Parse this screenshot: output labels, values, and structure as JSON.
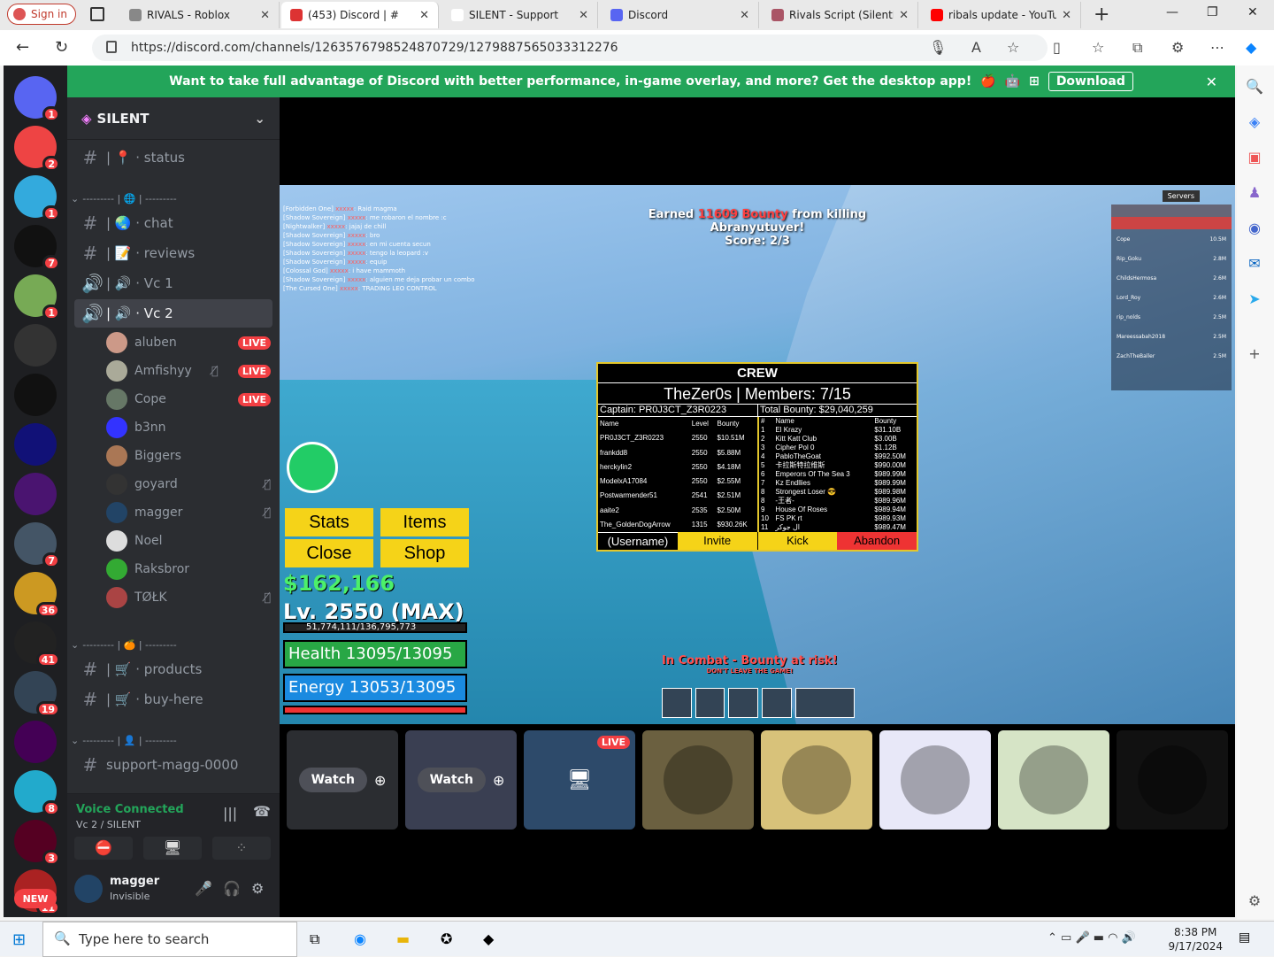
{
  "browser": {
    "signin": "Sign in",
    "tabs": [
      {
        "title": "RIVALS - Roblox",
        "fav": "#888"
      },
      {
        "title": "(453) Discord | #",
        "fav": "#d33",
        "active": true
      },
      {
        "title": "SILENT - Support",
        "fav": "#fff"
      },
      {
        "title": "Discord",
        "fav": "#5865f2"
      },
      {
        "title": "Rivals Script (SilentHub",
        "fav": "#a56"
      },
      {
        "title": "ribals update - YouTub",
        "fav": "#f00"
      }
    ],
    "url": "https://discord.com/channels/1263576798524870729/1279887565033312276"
  },
  "banner": {
    "text": "Want to take full advantage of Discord with better performance, in-game overlay, and more? Get the desktop app!",
    "download": "Download"
  },
  "server": {
    "name": "SILENT",
    "channels": [
      {
        "type": "text",
        "label": "| 📍 · status"
      },
      {
        "type": "category",
        "label": "--------- | 🌐 | ---------"
      },
      {
        "type": "text",
        "label": "| 🌏 · chat"
      },
      {
        "type": "text",
        "label": "| 📝 · reviews"
      },
      {
        "type": "voice",
        "label": "| 🔊 · Vc 1"
      },
      {
        "type": "voice",
        "label": "| 🔊 · Vc 2",
        "active": true
      }
    ],
    "voice_users": [
      {
        "name": "aluben",
        "live": "LIVE",
        "color": "#c98"
      },
      {
        "name": "Amfishyy",
        "live": "LIVE",
        "muted": true,
        "color": "#aa9"
      },
      {
        "name": "Cope",
        "live": "LIVE",
        "color": "#676"
      },
      {
        "name": "b3nn",
        "color": "#33f"
      },
      {
        "name": "Biggers",
        "color": "#a75"
      },
      {
        "name": "goyard",
        "muted": true,
        "color": "#333"
      },
      {
        "name": "magger",
        "muted": true,
        "color": "#246"
      },
      {
        "name": "Noel",
        "color": "#ddd"
      },
      {
        "name": "Raksbror",
        "color": "#3a3"
      },
      {
        "name": "TØŁK",
        "muted": true,
        "color": "#a44"
      }
    ],
    "channels2": [
      {
        "type": "category",
        "label": "--------- | 🍊 | ---------"
      },
      {
        "type": "text",
        "label": "| 🛒 · products"
      },
      {
        "type": "text",
        "label": "| 🛒 · buy-here"
      },
      {
        "type": "category",
        "label": "--------- | 👤 | ---------"
      },
      {
        "type": "text",
        "label": "support-magg-0000"
      }
    ]
  },
  "voice": {
    "status": "Voice Connected",
    "channel": "Vc 2 / SILENT"
  },
  "user": {
    "name": "magger",
    "status": "Invisible"
  },
  "guild_badges": [
    "1",
    "2",
    "1",
    "7",
    "1",
    "",
    "",
    "",
    "",
    "7",
    "36",
    "41",
    "19",
    "",
    "8",
    "3",
    "11"
  ],
  "new_label": "NEW",
  "game": {
    "earned_prefix": "Earned",
    "earned_bounty": "11609 Bounty",
    "earned_suffix": "from killing Abranyutuver!",
    "score": "Score: 2/3",
    "crew_title": "CREW",
    "crew_sub": "TheZer0s | Members: 7/15",
    "captain": "Captain: PR0J3CT_Z3R0223",
    "total_bounty": "Total Bounty: $29,040,259",
    "members": [
      [
        "PR0J3CT_Z3R0223",
        "2550",
        "$10.51M"
      ],
      [
        "frankdd8",
        "2550",
        "$5.88M"
      ],
      [
        "herckylin2",
        "2550",
        "$4.18M"
      ],
      [
        "ModelxA17084",
        "2550",
        "$2.55M"
      ],
      [
        "Postwarmender51",
        "2541",
        "$2.51M"
      ],
      [
        "aaite2",
        "2535",
        "$2.50M"
      ],
      [
        "The_GoldenDogArrow",
        "1315",
        "$930.26K"
      ]
    ],
    "rank": [
      [
        "1",
        "El Krazy",
        "$31.10B"
      ],
      [
        "2",
        "Kitt Katt Club",
        "$3.00B"
      ],
      [
        "3",
        "Cipher Pol 0",
        "$1.12B"
      ],
      [
        "4",
        "PabloTheGoat",
        "$992.50M"
      ],
      [
        "5",
        "卡拉斯特拉维斯",
        "$990.00M"
      ],
      [
        "6",
        "Emperors Of The Sea 3",
        "$989.99M"
      ],
      [
        "7",
        "Kz Endllies",
        "$989.99M"
      ],
      [
        "8",
        "Strongest Loser 😎",
        "$989.98M"
      ],
      [
        "8",
        "-王者-",
        "$989.96M"
      ],
      [
        "9",
        "House Of Roses",
        "$989.94M"
      ],
      [
        "10",
        "FS PK rt",
        "$989.93M"
      ],
      [
        "11",
        "ال جوكر",
        "$989.47M"
      ]
    ],
    "btn_username": "(Username)",
    "btn_invite": "Invite",
    "btn_kick": "Kick",
    "btn_abandon": "Abandon",
    "stats": "Stats",
    "items": "Items",
    "close": "Close",
    "shop": "Shop",
    "money": "$162,166",
    "level": "Lv. 2550 (MAX)",
    "xp": "51,774,111/136,795,773",
    "health": "Health 13095/13095",
    "energy": "Energy 13053/13095",
    "combat": "In Combat - Bounty at risk!",
    "combat_sub": "DON'T LEAVE THE GAME!",
    "leaderboard": [
      [
        "Cope",
        "10.5M"
      ],
      [
        "Rip_Goku",
        "2.8M"
      ],
      [
        "ChildsHermosa",
        "2.6M"
      ],
      [
        "Lord_Roy",
        "2.6M"
      ],
      [
        "rip_nolds",
        "2.5M"
      ],
      [
        "Mareessabah2018",
        "2.5M"
      ],
      [
        "ZachTheBaller",
        "2.5M"
      ]
    ],
    "servers": "Servers"
  },
  "tiles": {
    "watch": "Watch",
    "live": "LIVE"
  },
  "taskbar": {
    "search": "Type here to search",
    "time": "8:38 PM",
    "date": "9/17/2024"
  }
}
